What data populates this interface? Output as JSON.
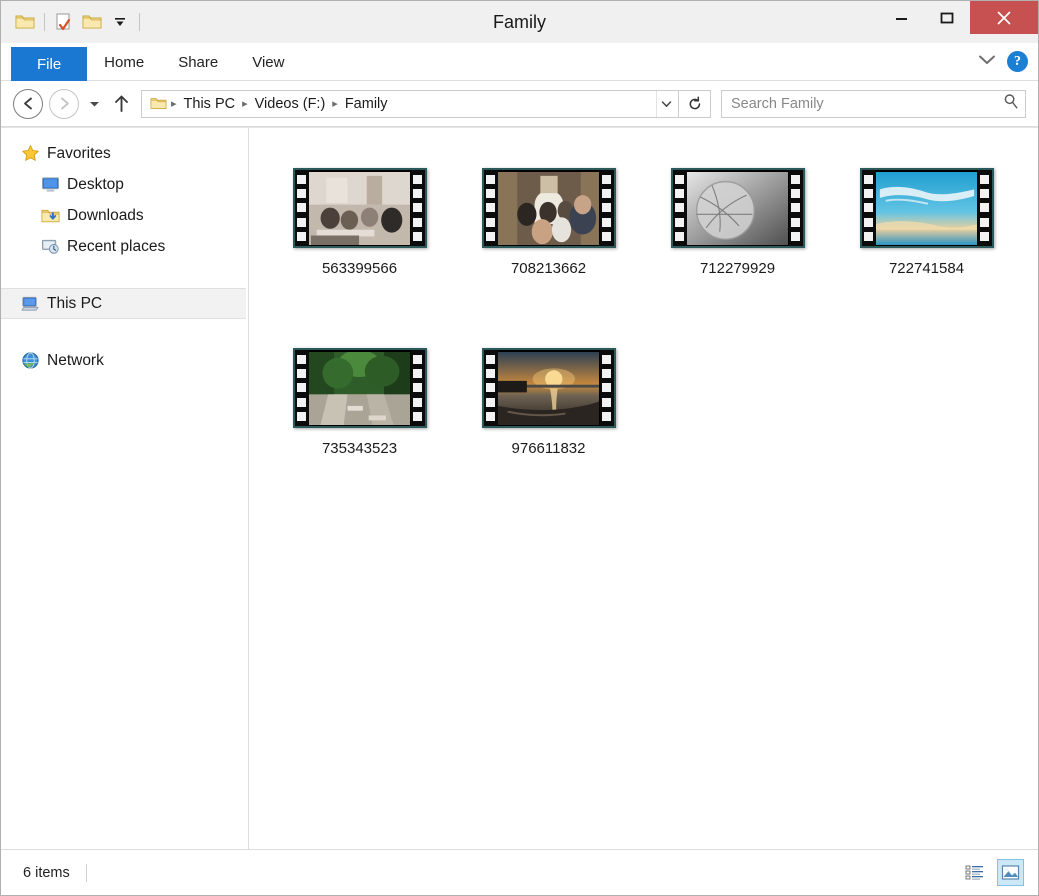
{
  "window": {
    "title": "Family",
    "controls": {
      "minimize_label": "Minimize",
      "maximize_label": "Maximize",
      "close_label": "Close"
    }
  },
  "quick_access": {
    "items": [
      {
        "name": "folder-icon",
        "label": "Folder"
      },
      {
        "name": "properties-icon",
        "label": "Properties"
      },
      {
        "name": "new-folder-icon",
        "label": "New folder"
      },
      {
        "name": "customize-dropdown-icon",
        "label": "Customize Quick Access Toolbar"
      }
    ]
  },
  "ribbon": {
    "file_tab": "File",
    "tabs": [
      {
        "label": "Home"
      },
      {
        "label": "Share"
      },
      {
        "label": "View"
      }
    ],
    "expand_label": "Expand the Ribbon",
    "help_label": "?"
  },
  "address_bar": {
    "back_label": "Back",
    "forward_label": "Forward",
    "recent_label": "Recent locations",
    "up_label": "Up",
    "breadcrumbs": [
      {
        "label": "This PC"
      },
      {
        "label": "Videos (F:)"
      },
      {
        "label": "Family"
      }
    ],
    "separator": "▸",
    "dropdown_label": "Previous locations",
    "refresh_label": "Refresh"
  },
  "search": {
    "placeholder": "Search Family",
    "value": "",
    "icon": "search-icon"
  },
  "sidebar": {
    "items": [
      {
        "label": "Favorites",
        "icon": "star-icon",
        "level": 0,
        "selected": false
      },
      {
        "label": "Desktop",
        "icon": "desktop-icon",
        "level": 1,
        "selected": false
      },
      {
        "label": "Downloads",
        "icon": "downloads-icon",
        "level": 1,
        "selected": false
      },
      {
        "label": "Recent places",
        "icon": "recent-places-icon",
        "level": 1,
        "selected": false
      },
      {
        "label": "This PC",
        "icon": "this-pc-icon",
        "level": 0,
        "selected": true
      },
      {
        "label": "Network",
        "icon": "network-icon",
        "level": 0,
        "selected": false
      }
    ]
  },
  "files": [
    {
      "name": "563399566",
      "type": "video",
      "thumb": "cafe-interior"
    },
    {
      "name": "708213662",
      "type": "video",
      "thumb": "crowd-indoor"
    },
    {
      "name": "712279929",
      "type": "video",
      "thumb": "greyscale-sphere"
    },
    {
      "name": "722741584",
      "type": "video",
      "thumb": "blue-sky-sea"
    },
    {
      "name": "735343523",
      "type": "video",
      "thumb": "tropical-road"
    },
    {
      "name": "976611832",
      "type": "video",
      "thumb": "beach-sunset"
    }
  ],
  "status_bar": {
    "item_count": "6 items",
    "views": [
      {
        "name": "details-view-button",
        "label": "Details view",
        "active": false
      },
      {
        "name": "large-icons-view-button",
        "label": "Large icons view",
        "active": true
      }
    ]
  },
  "colors": {
    "accent_blue": "#1a78d2",
    "close_red": "#c75050",
    "help_blue": "#1b7fd4",
    "selection_blue": "#cce8f7",
    "film_border": "#2c5a5a"
  }
}
